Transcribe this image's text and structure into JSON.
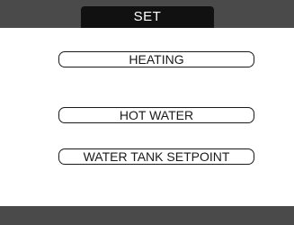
{
  "header": {
    "title": "SET"
  },
  "menu": {
    "items": [
      {
        "label": "HEATING"
      },
      {
        "label": "HOT WATER"
      },
      {
        "label": "WATER TANK SETPOINT"
      }
    ]
  },
  "colors": {
    "bar": "#4a4a4a",
    "title_tab": "#111111",
    "screen_background": "#ffffff",
    "button_outline": "#1a1a1a"
  }
}
